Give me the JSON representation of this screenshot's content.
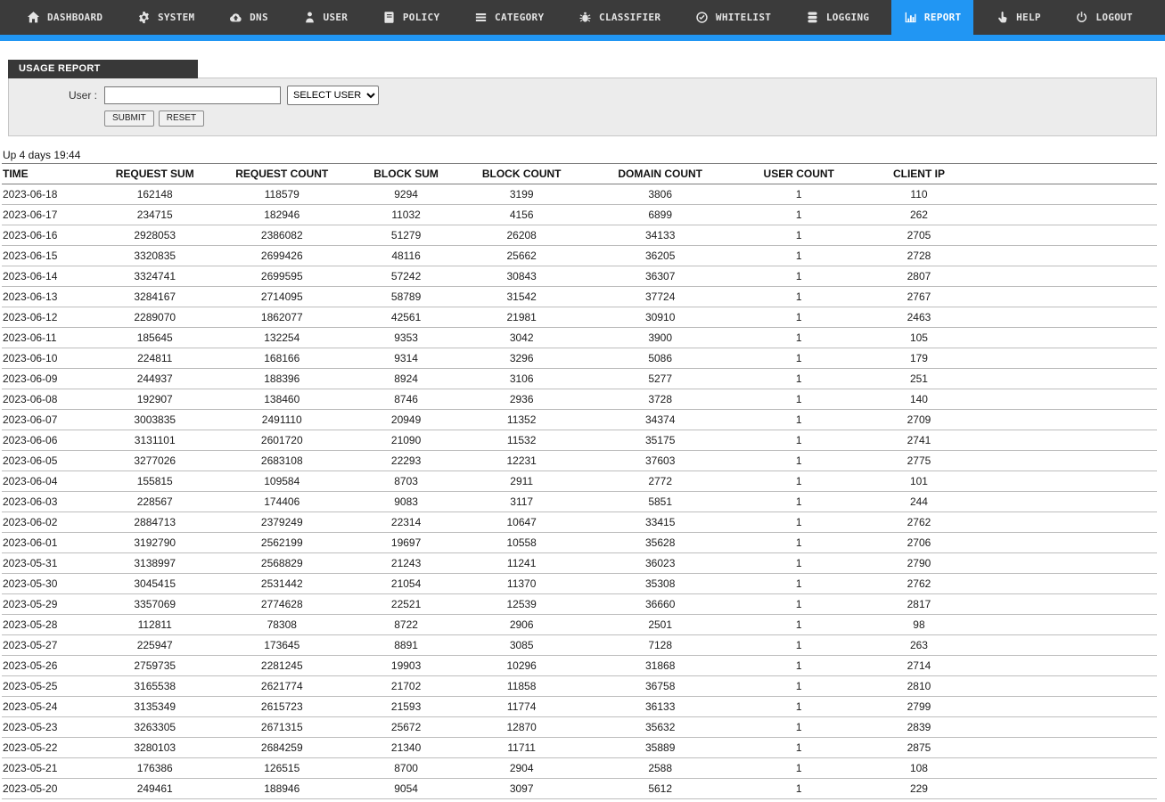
{
  "nav": {
    "accent_color": "#2196f3",
    "bar_color": "#3b3b3b",
    "items": [
      {
        "id": "dashboard",
        "label": "DASHBOARD",
        "icon": "home",
        "active": false
      },
      {
        "id": "system",
        "label": "SYSTEM",
        "icon": "gear",
        "active": false
      },
      {
        "id": "dns",
        "label": "DNS",
        "icon": "cloud-upload",
        "active": false
      },
      {
        "id": "user",
        "label": "USER",
        "icon": "person",
        "active": false
      },
      {
        "id": "policy",
        "label": "POLICY",
        "icon": "book",
        "active": false
      },
      {
        "id": "category",
        "label": "CATEGORY",
        "icon": "menu",
        "active": false
      },
      {
        "id": "classifier",
        "label": "CLASSIFIER",
        "icon": "bug",
        "active": false
      },
      {
        "id": "whitelist",
        "label": "WHITELIST",
        "icon": "check-circle",
        "active": false
      },
      {
        "id": "logging",
        "label": "LOGGING",
        "icon": "database",
        "active": false
      },
      {
        "id": "report",
        "label": "REPORT",
        "icon": "bar-chart",
        "active": true
      },
      {
        "id": "help",
        "label": "HELP",
        "icon": "hand",
        "active": false
      },
      {
        "id": "logout",
        "label": "LOGOUT",
        "icon": "power",
        "active": false
      }
    ]
  },
  "usage_report": {
    "panel_title": "USAGE REPORT",
    "user_label": "User :",
    "user_input_value": "",
    "user_select_value": "SELECT USER",
    "submit_label": "SUBMIT",
    "reset_label": "RESET"
  },
  "uptime_text": "Up 4 days 19:44",
  "table": {
    "columns": [
      "TIME",
      "REQUEST SUM",
      "REQUEST COUNT",
      "BLOCK SUM",
      "BLOCK COUNT",
      "DOMAIN COUNT",
      "USER COUNT",
      "CLIENT IP"
    ],
    "rows": [
      [
        "2023-06-18",
        162148,
        118579,
        9294,
        3199,
        3806,
        1,
        110
      ],
      [
        "2023-06-17",
        234715,
        182946,
        11032,
        4156,
        6899,
        1,
        262
      ],
      [
        "2023-06-16",
        2928053,
        2386082,
        51279,
        26208,
        34133,
        1,
        2705
      ],
      [
        "2023-06-15",
        3320835,
        2699426,
        48116,
        25662,
        36205,
        1,
        2728
      ],
      [
        "2023-06-14",
        3324741,
        2699595,
        57242,
        30843,
        36307,
        1,
        2807
      ],
      [
        "2023-06-13",
        3284167,
        2714095,
        58789,
        31542,
        37724,
        1,
        2767
      ],
      [
        "2023-06-12",
        2289070,
        1862077,
        42561,
        21981,
        30910,
        1,
        2463
      ],
      [
        "2023-06-11",
        185645,
        132254,
        9353,
        3042,
        3900,
        1,
        105
      ],
      [
        "2023-06-10",
        224811,
        168166,
        9314,
        3296,
        5086,
        1,
        179
      ],
      [
        "2023-06-09",
        244937,
        188396,
        8924,
        3106,
        5277,
        1,
        251
      ],
      [
        "2023-06-08",
        192907,
        138460,
        8746,
        2936,
        3728,
        1,
        140
      ],
      [
        "2023-06-07",
        3003835,
        2491110,
        20949,
        11352,
        34374,
        1,
        2709
      ],
      [
        "2023-06-06",
        3131101,
        2601720,
        21090,
        11532,
        35175,
        1,
        2741
      ],
      [
        "2023-06-05",
        3277026,
        2683108,
        22293,
        12231,
        37603,
        1,
        2775
      ],
      [
        "2023-06-04",
        155815,
        109584,
        8703,
        2911,
        2772,
        1,
        101
      ],
      [
        "2023-06-03",
        228567,
        174406,
        9083,
        3117,
        5851,
        1,
        244
      ],
      [
        "2023-06-02",
        2884713,
        2379249,
        22314,
        10647,
        33415,
        1,
        2762
      ],
      [
        "2023-06-01",
        3192790,
        2562199,
        19697,
        10558,
        35628,
        1,
        2706
      ],
      [
        "2023-05-31",
        3138997,
        2568829,
        21243,
        11241,
        36023,
        1,
        2790
      ],
      [
        "2023-05-30",
        3045415,
        2531442,
        21054,
        11370,
        35308,
        1,
        2762
      ],
      [
        "2023-05-29",
        3357069,
        2774628,
        22521,
        12539,
        36660,
        1,
        2817
      ],
      [
        "2023-05-28",
        112811,
        78308,
        8722,
        2906,
        2501,
        1,
        98
      ],
      [
        "2023-05-27",
        225947,
        173645,
        8891,
        3085,
        7128,
        1,
        263
      ],
      [
        "2023-05-26",
        2759735,
        2281245,
        19903,
        10296,
        31868,
        1,
        2714
      ],
      [
        "2023-05-25",
        3165538,
        2621774,
        21702,
        11858,
        36758,
        1,
        2810
      ],
      [
        "2023-05-24",
        3135349,
        2615723,
        21593,
        11774,
        36133,
        1,
        2799
      ],
      [
        "2023-05-23",
        3263305,
        2671315,
        25672,
        12870,
        35632,
        1,
        2839
      ],
      [
        "2023-05-22",
        3280103,
        2684259,
        21340,
        11711,
        35889,
        1,
        2875
      ],
      [
        "2023-05-21",
        176386,
        126515,
        8700,
        2904,
        2588,
        1,
        108
      ],
      [
        "2023-05-20",
        249461,
        188946,
        9054,
        3097,
        5612,
        1,
        229
      ]
    ]
  }
}
